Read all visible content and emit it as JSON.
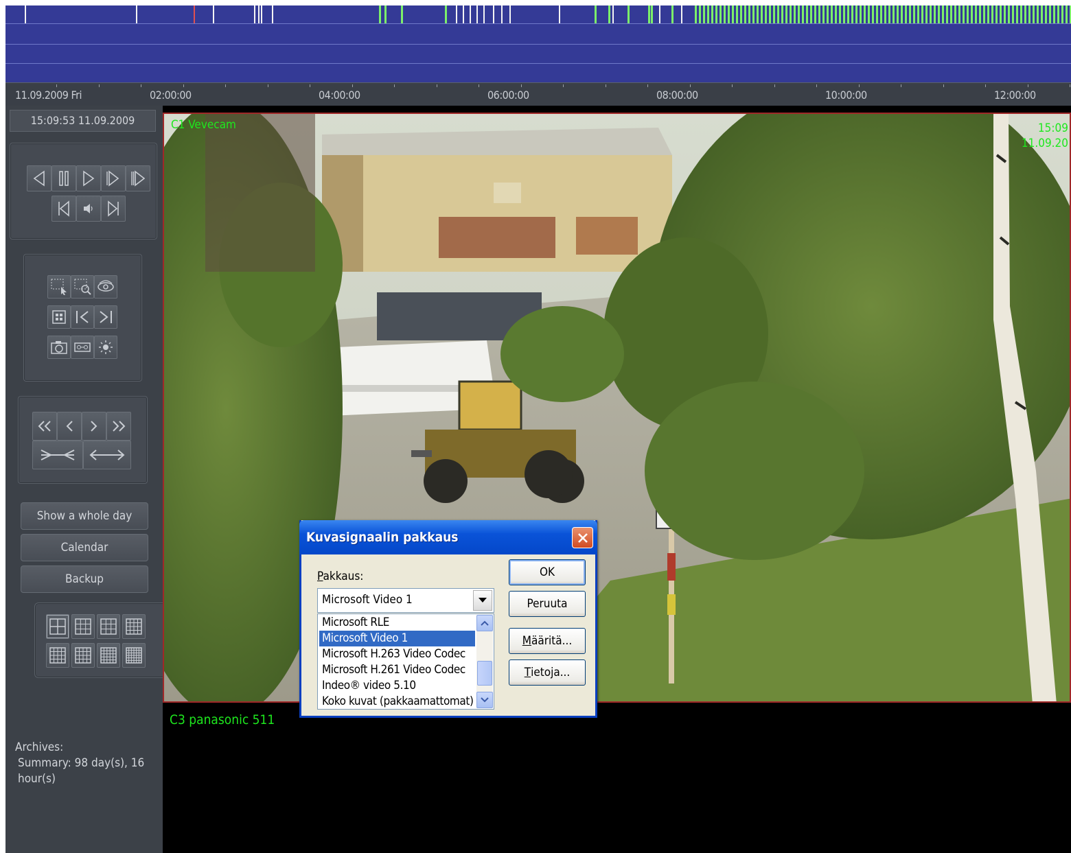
{
  "timeline": {
    "date": "11.09.2009 Fri",
    "hours": [
      "02:00:00",
      "04:00:00",
      "06:00:00",
      "08:00:00",
      "10:00:00",
      "12:00:00"
    ],
    "colors": {
      "track": "#343a96",
      "event_green": "#7cf06a",
      "event_white": "#f4f4f4",
      "event_red": "#e05050"
    }
  },
  "left_panel": {
    "clock": "15:09:53 11.09.2009",
    "show_day": "Show a whole day",
    "calendar": "Calendar",
    "backup": "Backup",
    "archives_label": "Archives:",
    "archives_summary": "Summary: 98 day(s), 16 hour(s)"
  },
  "video": {
    "cam1_title": "C1 Vevecam",
    "cam1_time": "15:09",
    "cam1_date": "11.09.20",
    "cam3_title": "C3 panasonic 511",
    "border_color": "#a02828",
    "overlay_color": "#1ee81e"
  },
  "dialog": {
    "title": "Kuvasignaalin pakkaus",
    "label_prefix": "P",
    "label_rest": "akkaus:",
    "selected": "Microsoft Video 1",
    "options": [
      "Microsoft RLE",
      "Microsoft Video 1",
      "Microsoft H.263 Video Codec",
      "Microsoft H.261 Video Codec",
      "Indeo® video 5.10",
      "Koko kuvat (pakkaamattomat)"
    ],
    "ok": "OK",
    "cancel": "Peruuta",
    "configure_a": "M",
    "configure_b": "ääritä...",
    "about_a": "T",
    "about_b": "ietoja..."
  }
}
